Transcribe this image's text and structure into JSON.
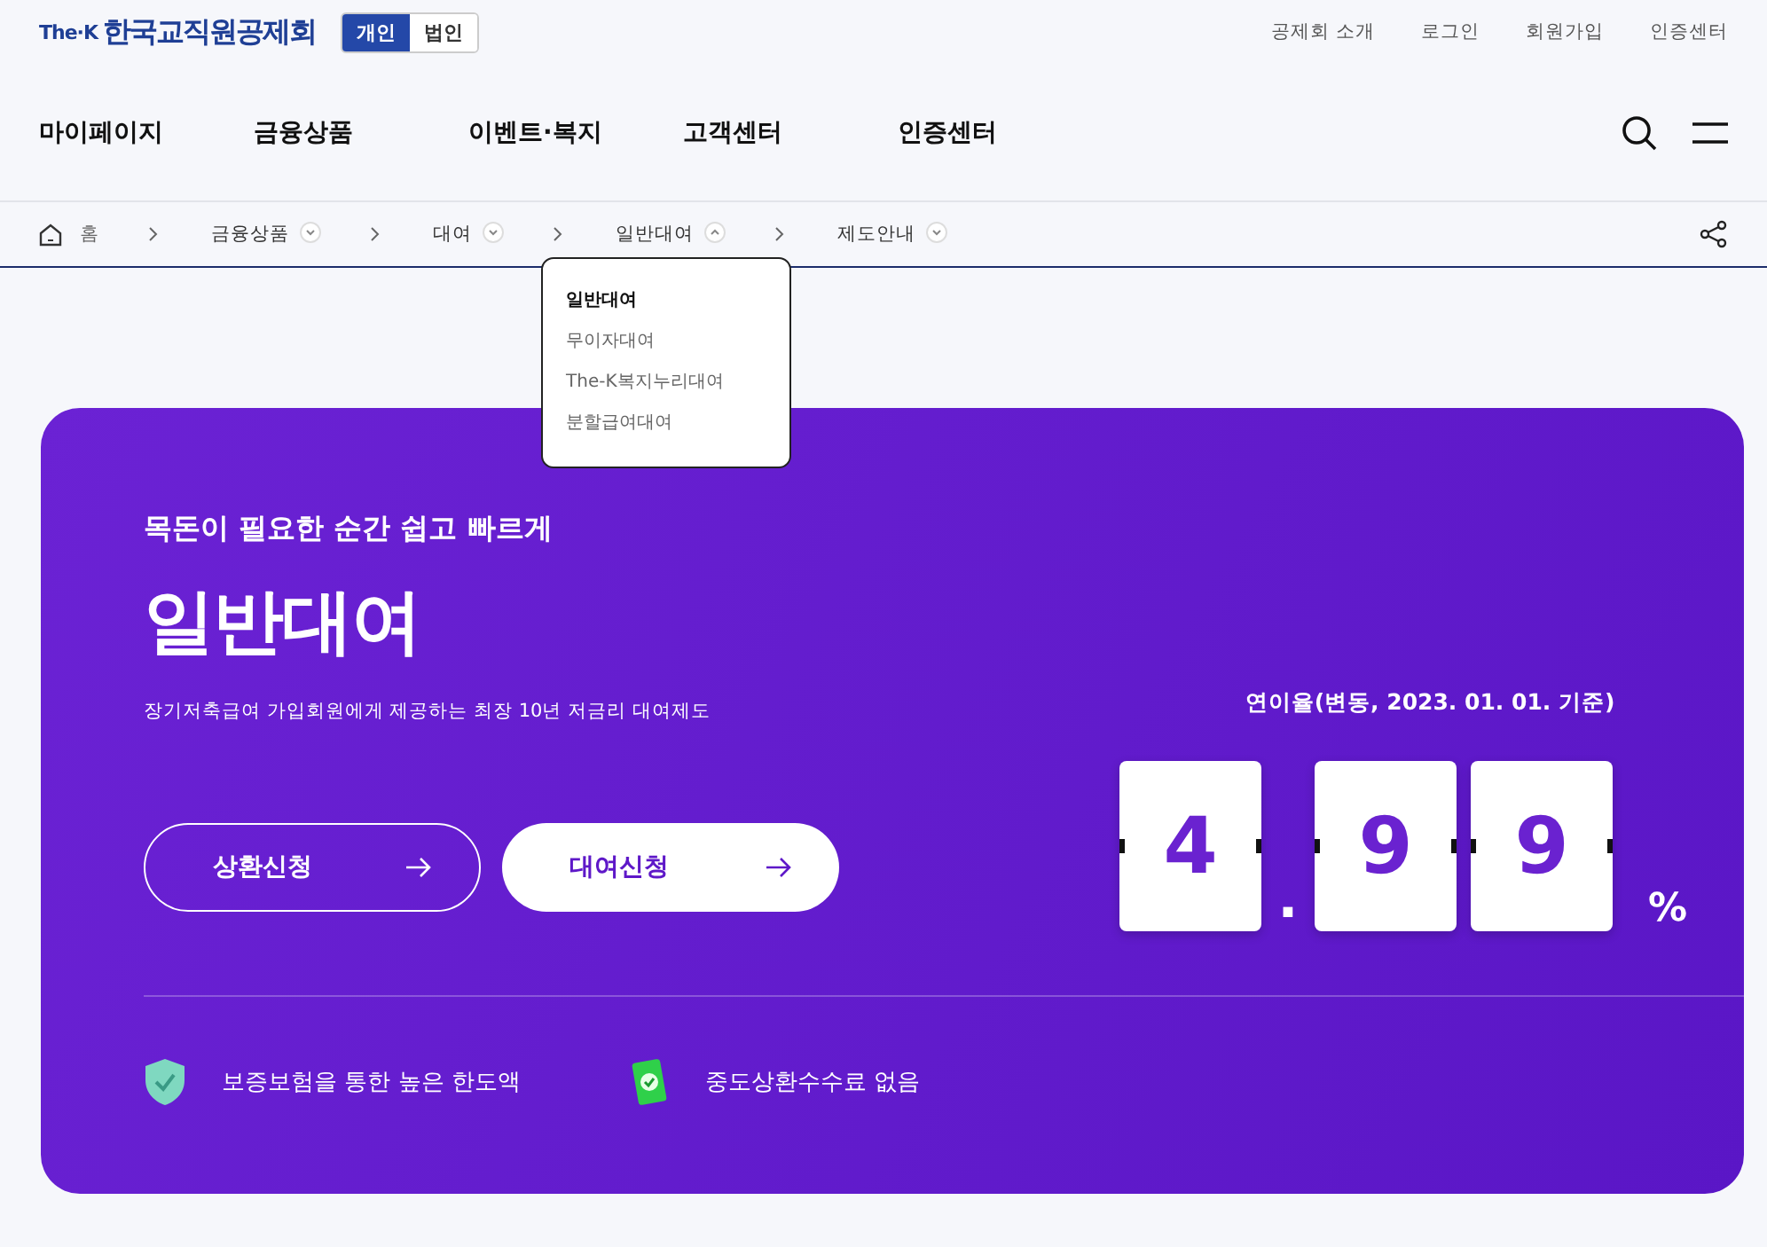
{
  "header": {
    "logo_prefix": "The·K",
    "logo_name": "한국교직원공제회",
    "member_tabs": [
      {
        "label": "개인",
        "selected": true
      },
      {
        "label": "법인",
        "selected": false
      }
    ],
    "utility_links": [
      "공제회 소개",
      "로그인",
      "회원가입",
      "인증센터"
    ],
    "nav": [
      "마이페이지",
      "금융상품",
      "이벤트·복지",
      "고객센터",
      "인증센터"
    ]
  },
  "breadcrumb": [
    {
      "label": "홈",
      "kind": "home"
    },
    {
      "label": "금융상품",
      "kind": "menu",
      "expanded": false
    },
    {
      "label": "대여",
      "kind": "menu",
      "expanded": false
    },
    {
      "label": "일반대여",
      "kind": "menu",
      "expanded": true
    },
    {
      "label": "제도안내",
      "kind": "menu",
      "expanded": false
    }
  ],
  "dropdown": [
    {
      "label": "일반대여",
      "selected": true
    },
    {
      "label": "무이자대여",
      "selected": false
    },
    {
      "label": "The-K복지누리대여",
      "selected": false
    },
    {
      "label": "분할급여대여",
      "selected": false
    }
  ],
  "hero": {
    "tagline": "목돈이 필요한 순간 쉽고 빠르게",
    "title": "일반대여",
    "description": "장기저축급여 가입회원에게 제공하는 최장 10년 저금리 대여제도",
    "buttons": [
      {
        "label": "상환신청",
        "kind": "outline"
      },
      {
        "label": "대여신청",
        "kind": "solid"
      }
    ],
    "rate_caption": "연이율(변동, 2023. 01. 01. 기준)",
    "rate": [
      {
        "kind": "digit",
        "text": "4"
      },
      {
        "kind": "dot",
        "text": "."
      },
      {
        "kind": "digit",
        "text": "9"
      },
      {
        "kind": "digit",
        "text": "9"
      },
      {
        "kind": "unit",
        "text": "%"
      }
    ],
    "features": [
      {
        "label": "보증보험을 통한 높은 한도액",
        "kind": "shield"
      },
      {
        "label": "중도상환수수료 없음",
        "kind": "money"
      }
    ]
  }
}
